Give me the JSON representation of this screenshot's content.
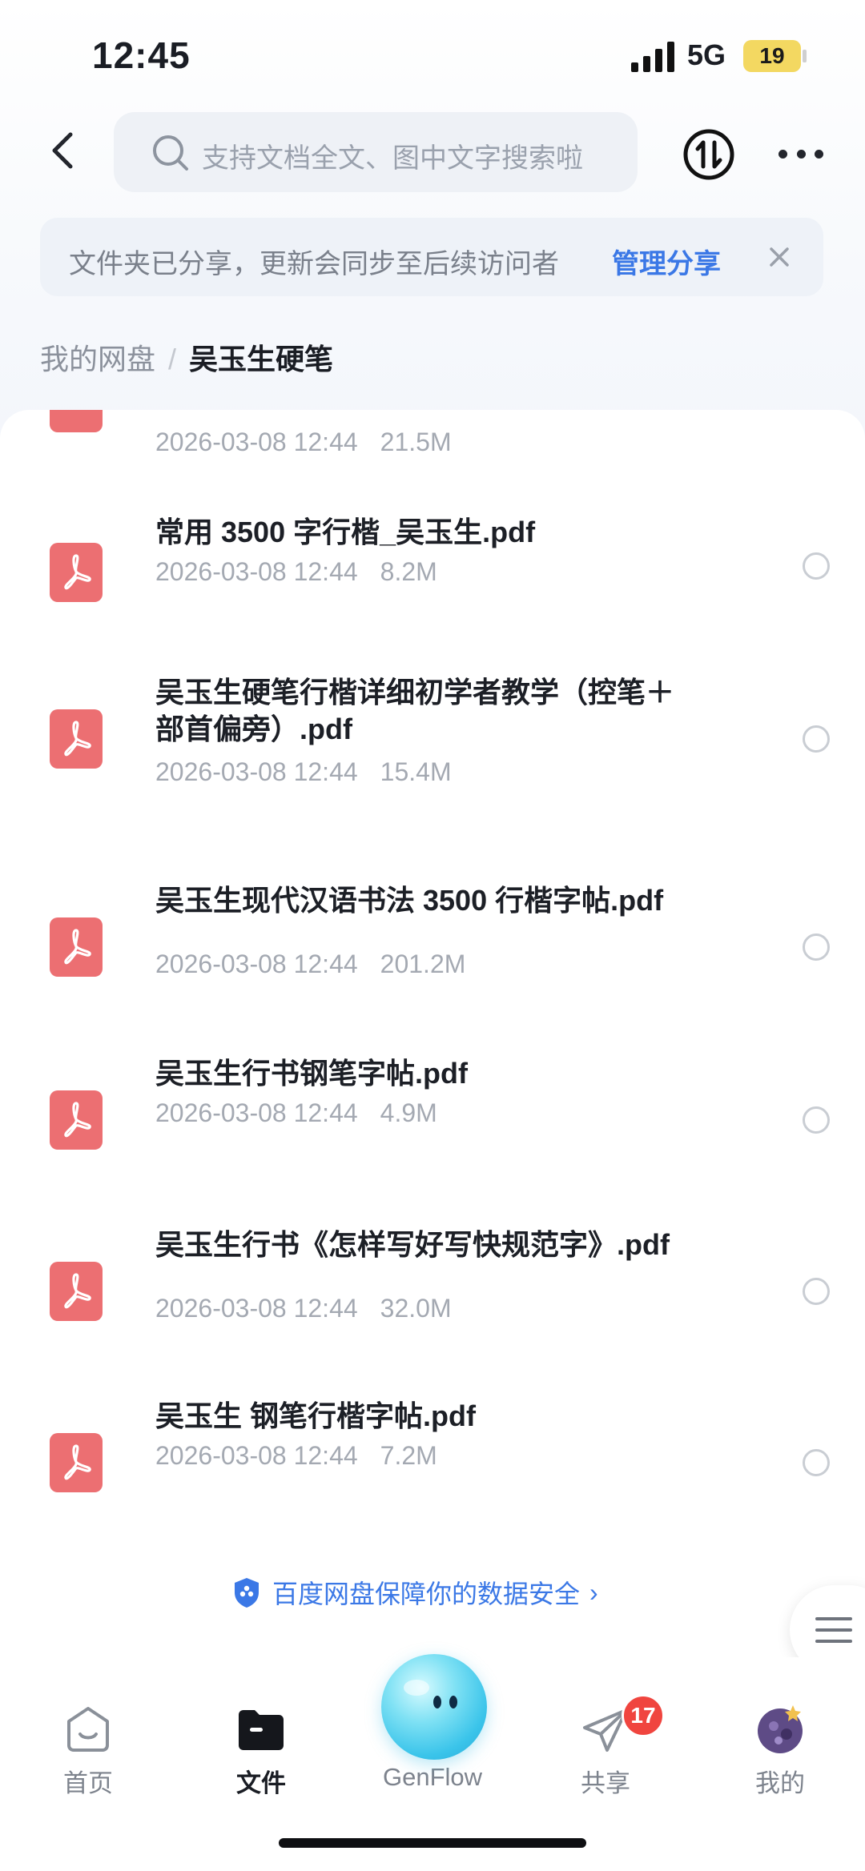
{
  "status_bar": {
    "time": "12:45",
    "network": "5G",
    "battery": "19"
  },
  "header": {
    "search_placeholder": "支持文档全文、图中文字搜索啦"
  },
  "share_banner": {
    "text": "文件夹已分享，更新会同步至后续访问者",
    "link": "管理分享"
  },
  "breadcrumb": {
    "root": "我的网盘",
    "separator": "/",
    "current": "吴玉生硬笔"
  },
  "files": [
    {
      "name": "",
      "date": "2026-03-08 12:44",
      "size": "21.5M"
    },
    {
      "name": "常用 3500 字行楷_吴玉生.pdf",
      "date": "2026-03-08 12:44",
      "size": "8.2M"
    },
    {
      "name": "吴玉生硬笔行楷详细初学者教学（控笔＋部首偏旁）.pdf",
      "date": "2026-03-08 12:44",
      "size": "15.4M"
    },
    {
      "name": "吴玉生现代汉语书法 3500 行楷字帖.pdf",
      "date": "2026-03-08 12:44",
      "size": "201.2M"
    },
    {
      "name": "吴玉生行书钢笔字帖.pdf",
      "date": "2026-03-08 12:44",
      "size": "4.9M"
    },
    {
      "name": "吴玉生行书《怎样写好写快规范字》.pdf",
      "date": "2026-03-08 12:44",
      "size": "32.0M"
    },
    {
      "name": "吴玉生 钢笔行楷字帖.pdf",
      "date": "2026-03-08 12:44",
      "size": "7.2M"
    }
  ],
  "safety_note": {
    "text": "百度网盘保障你的数据安全",
    "arrow": "›"
  },
  "nav": {
    "home": "首页",
    "files": "文件",
    "genflow": "GenFlow",
    "share": "共享",
    "share_badge": "17",
    "me": "我的"
  },
  "colors": {
    "accent": "#3b78e6",
    "pdf_red": "#ec6f72",
    "badge": "#f0453f"
  }
}
